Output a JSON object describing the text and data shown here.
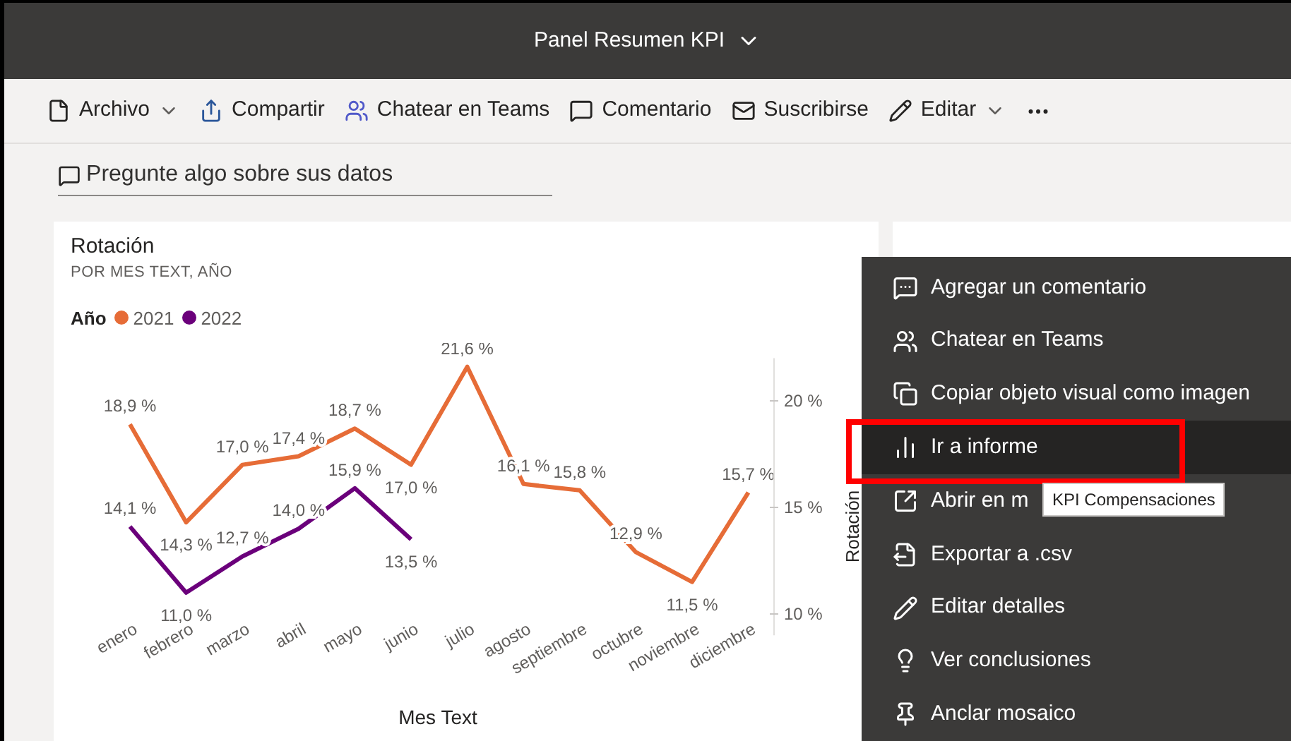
{
  "title_bar": {
    "title": "Panel Resumen KPI",
    "dropdown": true
  },
  "toolbar": [
    {
      "label": "Archivo",
      "dropdown": true
    },
    {
      "label": "Compartir",
      "dropdown": false
    },
    {
      "label": "Chatear en Teams",
      "dropdown": false
    },
    {
      "label": "Comentario",
      "dropdown": false
    },
    {
      "label": "Suscribirse",
      "dropdown": false
    },
    {
      "label": "Editar",
      "dropdown": true
    }
  ],
  "qna": {
    "placeholder": "Pregunte algo sobre sus datos"
  },
  "visual": {
    "subtitle": "POR MES TEXT, AÑO",
    "legend_title": "Año",
    "chart_data": {
      "type": "line",
      "title": "Rotación",
      "xlabel": "Mes Text",
      "ylabel": "Rotación",
      "categories": [
        "enero",
        "febrero",
        "marzo",
        "abril",
        "mayo",
        "junio",
        "julio",
        "agosto",
        "septiembre",
        "octubre",
        "noviembre",
        "diciembre"
      ],
      "series": [
        {
          "name": "2021",
          "color": "#e66c37",
          "values": [
            18.9,
            14.3,
            17.0,
            17.4,
            18.7,
            17.0,
            21.6,
            16.1,
            15.8,
            12.9,
            11.5,
            15.7
          ],
          "value_labels": [
            "18,9 %",
            "14,3 %",
            "17,0 %",
            "17,4 %",
            "18,7 %",
            "17,0 %",
            "21,6 %",
            "16,1 %",
            "15,8 %",
            "12,9 %",
            "11,5 %",
            "15,7 %"
          ]
        },
        {
          "name": "2022",
          "color": "#6b007b",
          "values": [
            14.1,
            11.0,
            12.7,
            14.0,
            15.9,
            13.5,
            null,
            null,
            null,
            null,
            null,
            null
          ],
          "value_labels": [
            "14,1 %",
            "11,0 %",
            "12,7 %",
            "14,0 %",
            "15,9 %",
            "13,5 %",
            null,
            null,
            null,
            null,
            null,
            null
          ]
        }
      ],
      "ylim": [
        9,
        22
      ],
      "yticks": [
        {
          "value": 20,
          "label": "20 %"
        },
        {
          "value": 15,
          "label": "15 %"
        },
        {
          "value": 10,
          "label": "10 %"
        }
      ],
      "data_labels": true
    }
  },
  "context_menu": {
    "items": [
      {
        "label": "Agregar un comentario",
        "selected": false
      },
      {
        "label": "Chatear en Teams",
        "selected": false
      },
      {
        "label": "Copiar objeto visual como imagen",
        "selected": false
      },
      {
        "label": "Ir a informe",
        "selected": true
      },
      {
        "label": "Abrir en m",
        "selected": false
      },
      {
        "label": "Exportar a .csv",
        "selected": false
      },
      {
        "label": "Editar detalles",
        "selected": false
      },
      {
        "label": "Ver conclusiones",
        "selected": false
      },
      {
        "label": "Anclar mosaico",
        "selected": false
      }
    ]
  },
  "tooltip": {
    "text": "KPI Compensaciones"
  }
}
